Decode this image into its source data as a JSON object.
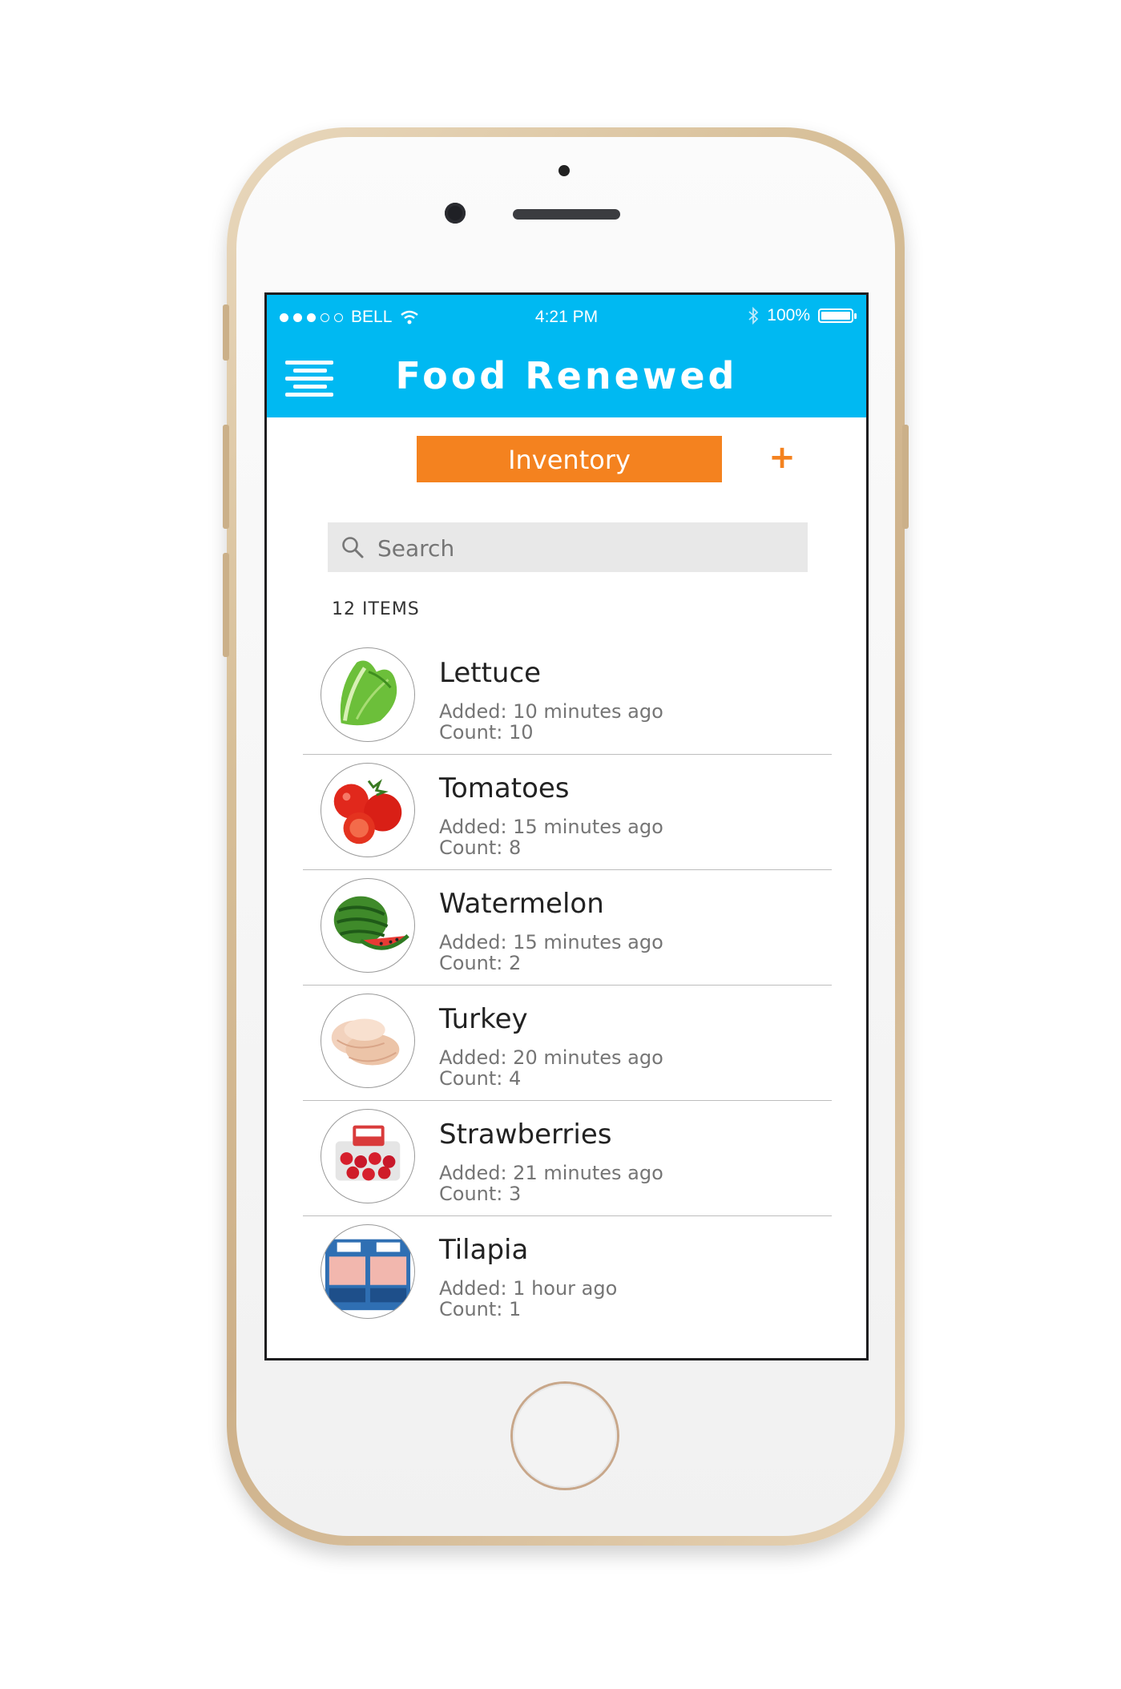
{
  "status_bar": {
    "carrier": "BELL",
    "time": "4:21 PM",
    "battery": "100%",
    "icons": [
      "signal-dots",
      "wifi-icon",
      "bluetooth-icon",
      "battery-icon"
    ]
  },
  "header": {
    "title": "Food Renewed",
    "menu_icon": "hamburger-menu-icon"
  },
  "toolbar": {
    "inventory_label": "Inventory",
    "add_label": "+"
  },
  "search": {
    "placeholder": "Search",
    "icon": "search-icon"
  },
  "item_count": "12 ITEMS",
  "items": [
    {
      "name": "Lettuce",
      "added": "Added: 10 minutes ago",
      "count": "Count: 10",
      "image": "lettuce"
    },
    {
      "name": "Tomatoes",
      "added": "Added: 15 minutes ago",
      "count": "Count: 8",
      "image": "tomatoes"
    },
    {
      "name": "Watermelon",
      "added": "Added: 15 minutes ago",
      "count": "Count: 2",
      "image": "watermelon"
    },
    {
      "name": "Turkey",
      "added": "Added: 20 minutes ago",
      "count": "Count: 4",
      "image": "turkey"
    },
    {
      "name": "Strawberries",
      "added": "Added: 21 minutes ago",
      "count": "Count: 3",
      "image": "strawberries"
    },
    {
      "name": "Tilapia",
      "added": "Added: 1 hour ago",
      "count": "Count: 1",
      "image": "tilapia"
    }
  ],
  "colors": {
    "primary": "#00b9f2",
    "accent": "#f4821f",
    "search_bg": "#e8e8e8"
  }
}
